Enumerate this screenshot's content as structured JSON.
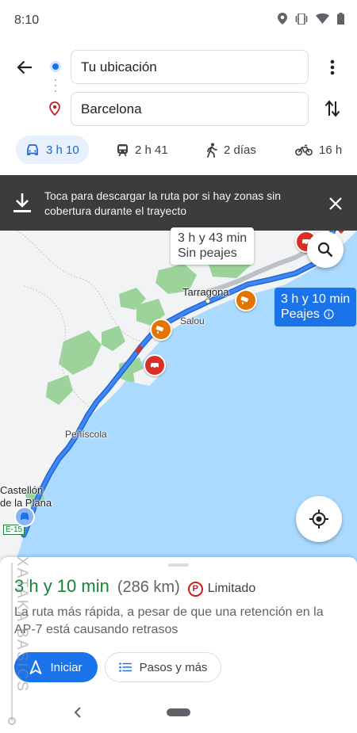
{
  "status_bar": {
    "time": "8:10",
    "icons": [
      "location-icon",
      "vibrate-icon",
      "wifi-icon",
      "battery-icon"
    ]
  },
  "route": {
    "origin": "Tu ubicación",
    "destination": "Barcelona"
  },
  "modes": [
    {
      "name": "car",
      "icon": "car-icon",
      "label": "3 h 10",
      "selected": true
    },
    {
      "name": "transit",
      "icon": "train-icon",
      "label": "2 h 41",
      "selected": false
    },
    {
      "name": "walk",
      "icon": "walk-icon",
      "label": "2 días",
      "selected": false
    },
    {
      "name": "bike",
      "icon": "bike-icon",
      "label": "16 h",
      "selected": false
    }
  ],
  "banner": {
    "text": "Toca para descargar la ruta por si hay zonas sin cobertura durante el trayecto"
  },
  "map": {
    "alt_route": {
      "time": "3 h y 43 min",
      "note": "Sin peajes"
    },
    "main_route": {
      "time": "3 h y 10 min",
      "note": "Peajes"
    },
    "labels": {
      "tarragona": "Tarragona",
      "salou": "Salou",
      "peniscola": "Peñíscola",
      "castellon_1": "Castellón",
      "castellon_2": "de la Plana",
      "highway": "E-15"
    },
    "colors": {
      "water": "#aadaff",
      "land": "#f1f3f4",
      "park": "#9bd39b",
      "route": "#1a73e8",
      "alt_route": "#bdc1c6"
    }
  },
  "sheet": {
    "duration": "3 h y 10 min",
    "distance": "(286 km)",
    "parking": "Limitado",
    "description": "La ruta más rápida, a pesar de que una retención en la AP-7 está causando retrasos",
    "start_label": "Iniciar",
    "steps_label": "Pasos y más"
  },
  "watermark": "XATAKA BASICS"
}
